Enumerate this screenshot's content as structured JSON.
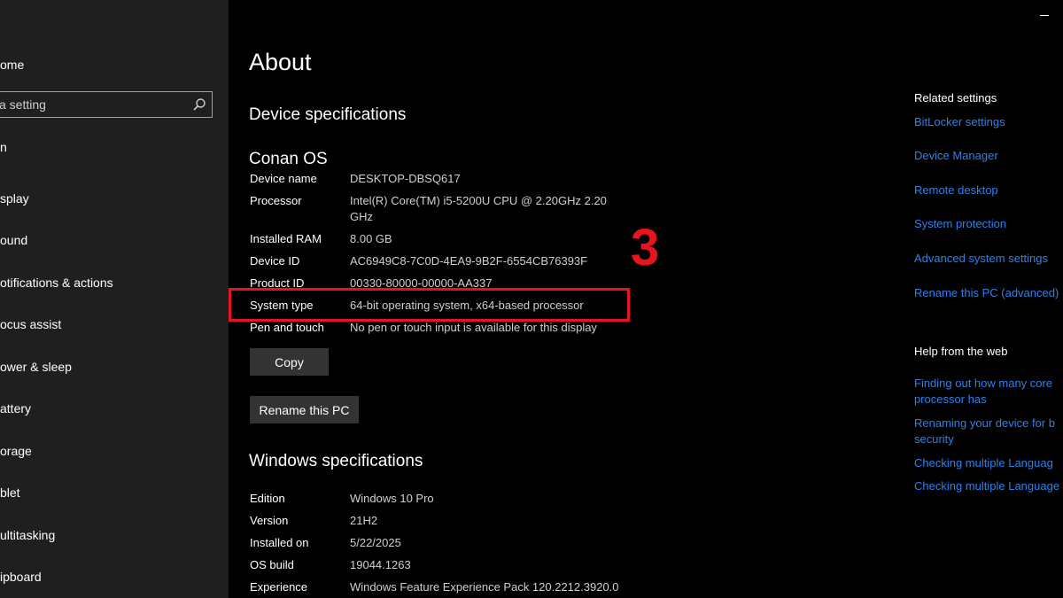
{
  "sidebar": {
    "home_label": "ome",
    "search_placeholder": "a setting",
    "partial_item": "n",
    "items": [
      {
        "label": "splay"
      },
      {
        "label": "ound"
      },
      {
        "label": "otifications & actions"
      },
      {
        "label": "ocus assist"
      },
      {
        "label": "ower & sleep"
      },
      {
        "label": "attery"
      },
      {
        "label": "orage"
      },
      {
        "label": "blet"
      },
      {
        "label": "ultitasking"
      },
      {
        "label": "ipboard"
      }
    ]
  },
  "main": {
    "title": "About",
    "device_specs_heading": "Device specifications",
    "device_display_name": "Conan OS",
    "device_specs": [
      {
        "label": "Device name",
        "value": "DESKTOP-DBSQ617"
      },
      {
        "label": "Processor",
        "value": "Intel(R) Core(TM) i5-5200U CPU @ 2.20GHz   2.20",
        "value2": "GHz"
      },
      {
        "label": "Installed RAM",
        "value": "8.00 GB"
      },
      {
        "label": "Device ID",
        "value": "AC6949C8-7C0D-4EA9-9B2F-6554CB76393F"
      },
      {
        "label": "Product ID",
        "value": "00330-80000-00000-AA337"
      },
      {
        "label": "System type",
        "value": "64-bit operating system, x64-based processor"
      },
      {
        "label": "Pen and touch",
        "value": "No pen or touch input is available for this display"
      }
    ],
    "copy_button": "Copy",
    "rename_button": "Rename this PC",
    "windows_specs_heading": "Windows specifications",
    "windows_specs": [
      {
        "label": "Edition",
        "value": "Windows 10 Pro"
      },
      {
        "label": "Version",
        "value": "21H2"
      },
      {
        "label": "Installed on",
        "value": "5/22/2025"
      },
      {
        "label": "OS build",
        "value": "19044.1263"
      },
      {
        "label": "Experience",
        "value": "Windows Feature Experience Pack 120.2212.3920.0"
      }
    ],
    "annotation_number": "3",
    "annotation_color": "#e8141d"
  },
  "related": {
    "heading": "Related settings",
    "links": [
      {
        "label": "BitLocker settings"
      },
      {
        "label": "Device Manager"
      },
      {
        "label": "Remote desktop"
      },
      {
        "label": "System protection"
      },
      {
        "label": "Advanced system settings"
      },
      {
        "label": "Rename this PC (advanced)"
      }
    ]
  },
  "help": {
    "heading": "Help from the web",
    "links": [
      {
        "line1": "Finding out how many core",
        "line2": "processor has"
      },
      {
        "line1": "Renaming your device for b",
        "line2": "security"
      },
      {
        "line1": "Checking multiple Languag",
        "line2": ""
      },
      {
        "line1": "Checking multiple Language",
        "line2": ""
      }
    ]
  },
  "colors": {
    "sidebar_bg": "#1f1f1f",
    "main_bg": "#000000",
    "link": "#2f80e7",
    "button_bg": "#333333"
  }
}
